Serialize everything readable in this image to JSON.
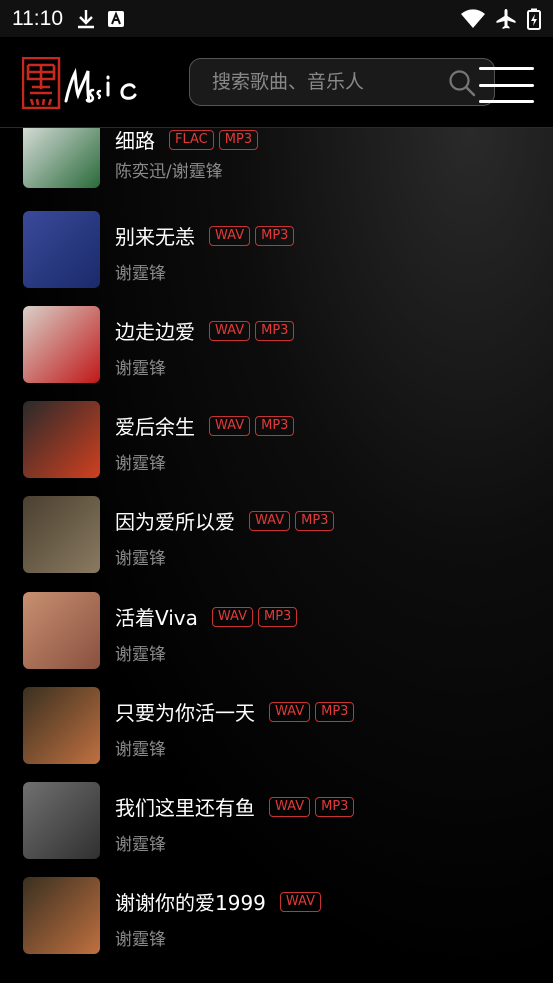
{
  "status_bar": {
    "time": "11:10"
  },
  "header": {
    "logo_text": "Music",
    "search_placeholder": "搜索歌曲、音乐人"
  },
  "songs": [
    {
      "title": "细路",
      "artist": "陈奕迅/谢霆锋",
      "formats": [
        "FLAC",
        "MP3"
      ],
      "cover_colors": [
        "#e8e8e8",
        "#2a6a3a"
      ]
    },
    {
      "title": "别来无恙",
      "artist": "谢霆锋",
      "formats": [
        "WAV",
        "MP3"
      ],
      "cover_colors": [
        "#3a4a9a",
        "#1a2a6a"
      ]
    },
    {
      "title": "边走边爱",
      "artist": "谢霆锋",
      "formats": [
        "WAV",
        "MP3"
      ],
      "cover_colors": [
        "#d8d0c8",
        "#c01818"
      ]
    },
    {
      "title": "爱后余生",
      "artist": "谢霆锋",
      "formats": [
        "WAV",
        "MP3"
      ],
      "cover_colors": [
        "#2a2a2a",
        "#d04020"
      ]
    },
    {
      "title": "因为爱所以爱",
      "artist": "谢霆锋",
      "formats": [
        "WAV",
        "MP3"
      ],
      "cover_colors": [
        "#4a4030",
        "#8a7a60"
      ]
    },
    {
      "title": "活着Viva",
      "artist": "谢霆锋",
      "formats": [
        "WAV",
        "MP3"
      ],
      "cover_colors": [
        "#c89070",
        "#8a5040"
      ]
    },
    {
      "title": "只要为你活一天",
      "artist": "谢霆锋",
      "formats": [
        "WAV",
        "MP3"
      ],
      "cover_colors": [
        "#3a3020",
        "#c07040"
      ]
    },
    {
      "title": "我们这里还有鱼",
      "artist": "谢霆锋",
      "formats": [
        "WAV",
        "MP3"
      ],
      "cover_colors": [
        "#707070",
        "#303030"
      ]
    },
    {
      "title": "谢谢你的爱1999",
      "artist": "谢霆锋",
      "formats": [
        "WAV"
      ],
      "cover_colors": [
        "#3a3020",
        "#c07040"
      ]
    }
  ],
  "colors": {
    "badge": "#e03a3a",
    "logo": "#c8281e"
  }
}
